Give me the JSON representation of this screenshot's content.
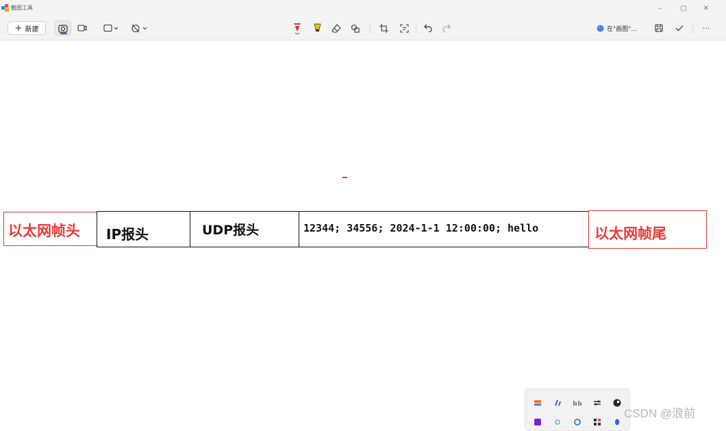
{
  "window": {
    "title": "截图工具",
    "controls": {
      "minimize": "–",
      "restore": "▢",
      "close": "✕"
    }
  },
  "toolbar": {
    "new_label": "新建",
    "share_label": "在\"画图\"...",
    "more_label": "···"
  },
  "icons": {
    "app": "snipping-tool-icon",
    "snip": "camera-icon",
    "record": "video-icon",
    "shape": "rectangle-snip-icon",
    "timer": "timer-off-icon",
    "pen": "ballpoint-pen-icon",
    "highlighter": "highlighter-icon",
    "eraser": "eraser-icon",
    "shapes": "shapes-icon",
    "crop": "crop-icon",
    "ocr": "text-actions-icon",
    "undo": "undo-icon",
    "redo": "redo-icon",
    "paint": "paint-app-icon",
    "save": "save-icon",
    "copy": "check-icon"
  },
  "canvas": {
    "packet": {
      "eth_header": "以太网帧头",
      "ip_header": "IP报头",
      "udp_header": "UDP报头",
      "payload": "12344; 34556; 2024-1-1 12:00:00; hello",
      "eth_trailer": "以太网帧尾"
    }
  },
  "watermark": "CSDN @浪前",
  "colors": {
    "accent": "#5b3fd4",
    "annotation_red": "#e53935",
    "pen_red": "#d32f2f",
    "highlighter_yellow": "#f5c400"
  }
}
